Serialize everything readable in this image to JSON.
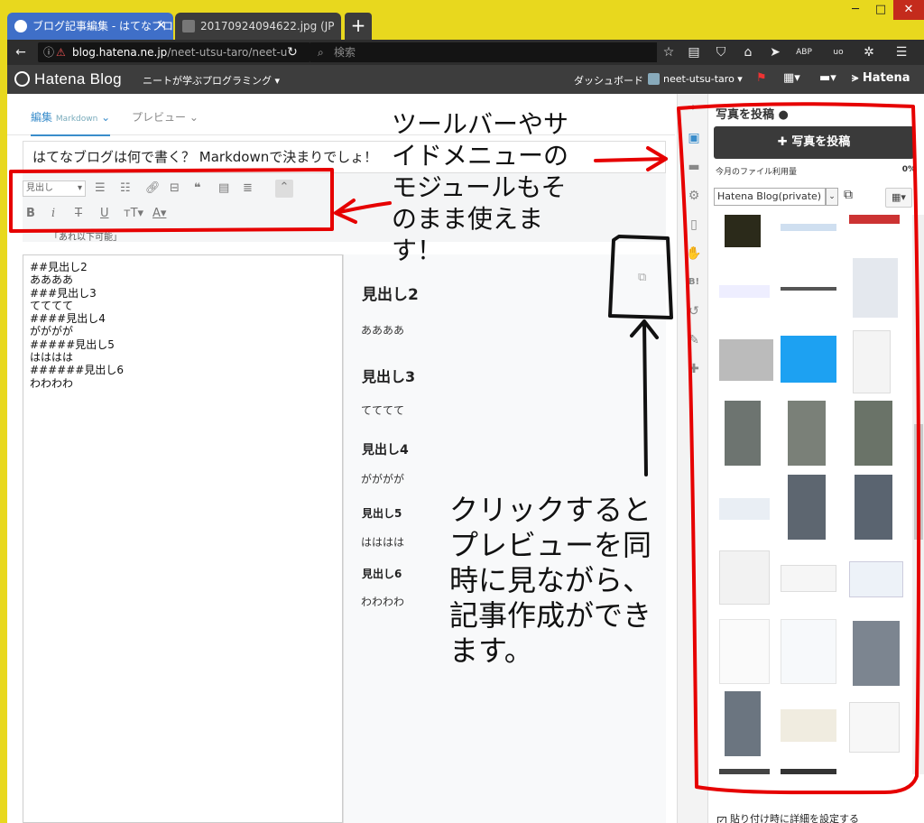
{
  "browser": {
    "tabs": [
      {
        "title": "ブログ記事編集 - はてなブログ"
      },
      {
        "title": "20170924094622.jpg (JP"
      }
    ],
    "new_tab_label": "+",
    "url": {
      "host": "blog.hatena.ne.jp",
      "path": "/neet-utsu-taro/neet-u"
    },
    "search_placeholder": "検索",
    "window_controls": {
      "minimize": "─",
      "maximize": "□",
      "close": "✕"
    }
  },
  "header": {
    "logo": "Hatena Blog",
    "blog_name": "ニートが学ぶプログラミング",
    "dashboard": "ダッシュボード",
    "user": "neet-utsu-taro",
    "brand": "Hatena"
  },
  "editor": {
    "tabs": {
      "edit": "編集",
      "edit_mode": "Markdown",
      "preview": "プレビュー"
    },
    "title": "はてなブログは何で書く？ Markdownで決まりでしょ！",
    "toolbar": {
      "heading_select": "見出し"
    },
    "notice": "「あれ以下可能」",
    "markdown_lines": [
      "##見出し2",
      "ああああ",
      "###見出し3",
      "てててて",
      "####見出し4",
      "がががが",
      "#####見出し5",
      "はははは",
      "######見出し6",
      "わわわわ"
    ],
    "preview": [
      {
        "heading": "見出し2",
        "text": "ああああ"
      },
      {
        "heading": "見出し3",
        "text": "てててて"
      },
      {
        "heading": "見出し4",
        "text": "がががが"
      },
      {
        "heading": "見出し5",
        "text": "はははは"
      },
      {
        "heading": "見出し6",
        "text": "わわわわ"
      }
    ]
  },
  "photo_panel": {
    "title": "写真を投稿",
    "upload_button": "写真を投稿",
    "usage_label": "今月のファイル利用量",
    "usage_value": "0%",
    "album": "Hatena Blog(private)",
    "paste_option": "貼り付け時に詳細を設定する"
  },
  "annotations": {
    "top": "ツールバーやサ\nイドメニューの\nモジュールもそ\nのまま使えま\nす！",
    "bottom": "クリックすると\nプレビューを同\n時に見ながら、\n記事作成ができ\nます。"
  },
  "colors": {
    "window_frame": "#e8d81e",
    "annotation_red": "#e60000",
    "header_dark": "#3d3d3d",
    "accent_blue": "#3a8dcb"
  }
}
